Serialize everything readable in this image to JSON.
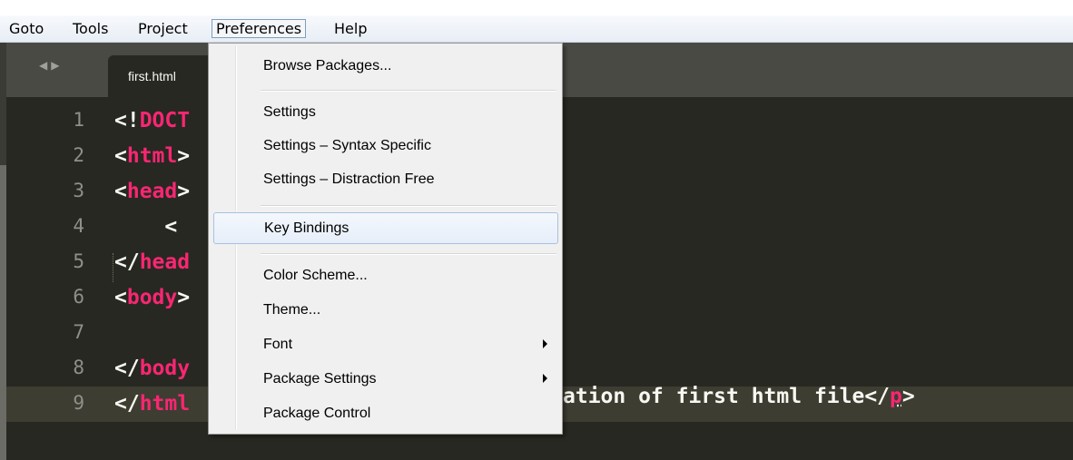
{
  "menubar": {
    "items": [
      "Goto",
      "Tools",
      "Project",
      "Preferences",
      "Help"
    ],
    "active": "Preferences"
  },
  "editor": {
    "tab_label": "first.html",
    "tab_nav_arrows": "◀▶",
    "lines": [
      {
        "num": "1",
        "prefix": "<!",
        "tag": "DOCT",
        "suffix": ""
      },
      {
        "num": "2",
        "prefix": "<",
        "tag": "html",
        "suffix": ">"
      },
      {
        "num": "3",
        "prefix": "<",
        "tag": "head",
        "suffix": ">"
      },
      {
        "num": "4",
        "prefix": "    <",
        "tag": "",
        "suffix": ""
      },
      {
        "num": "5",
        "prefix": "</",
        "tag": "head",
        "suffix": ""
      },
      {
        "num": "6",
        "prefix": "<",
        "tag": "body",
        "suffix": ">"
      },
      {
        "num": "7",
        "prefix": "",
        "tag": "",
        "suffix": ""
      },
      {
        "num": "8",
        "prefix": "</",
        "tag": "body",
        "suffix": ""
      },
      {
        "num": "9",
        "prefix": "</",
        "tag": "html",
        "suffix": ""
      }
    ],
    "line9_tail": {
      "text": "ation of first html file</",
      "tag": "p",
      "close": ">"
    },
    "current_line": "9",
    "colors": {
      "background": "#272822",
      "tag": "#f92672",
      "text": "#f8f8f2",
      "gutter_number": "#90908a"
    }
  },
  "preferences_menu": {
    "items": [
      {
        "label": "Browse Packages..."
      },
      {
        "label": "Settings"
      },
      {
        "label": "Settings – Syntax Specific"
      },
      {
        "label": "Settings – Distraction Free"
      },
      {
        "label": "Key Bindings",
        "highlighted": true
      },
      {
        "label": "Color Scheme..."
      },
      {
        "label": "Theme..."
      },
      {
        "label": "Font",
        "submenu": true
      },
      {
        "label": "Package Settings",
        "submenu": true
      },
      {
        "label": "Package Control"
      }
    ]
  }
}
